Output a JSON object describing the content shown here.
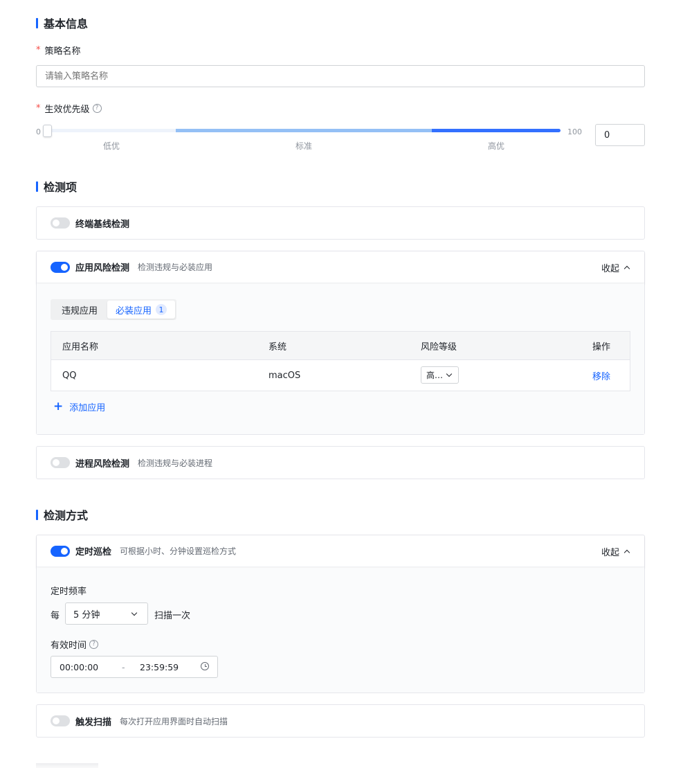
{
  "basic": {
    "title": "基本信息",
    "name_label": "策略名称",
    "name_placeholder": "请输入策略名称",
    "priority_label": "生效优先级",
    "help_glyph": "?",
    "slider": {
      "min": "0",
      "max": "100",
      "value": 0,
      "ticks": [
        "低优",
        "标准",
        "高优"
      ],
      "colors": [
        "#eef3fb",
        "#94c0f5",
        "#3370ff"
      ]
    },
    "priority_value": "0"
  },
  "detect": {
    "title": "检测项",
    "terminal": {
      "title": "终端基线检测",
      "on": false
    },
    "app_risk": {
      "title": "应用风险检测",
      "desc": "检测违规与必装应用",
      "collapse": "收起",
      "on": true,
      "tabs": [
        {
          "label": "违规应用"
        },
        {
          "label": "必装应用",
          "count": "1"
        }
      ],
      "table": {
        "headers": [
          "应用名称",
          "系统",
          "风险等级",
          "操作"
        ],
        "rows": [
          {
            "name": "QQ",
            "system": "macOS",
            "level": "高…",
            "action": "移除"
          }
        ]
      },
      "add": "添加应用"
    },
    "process_risk": {
      "title": "进程风险检测",
      "desc": "检测违规与必装进程",
      "on": false
    }
  },
  "method": {
    "title": "检测方式",
    "scheduled": {
      "title": "定时巡检",
      "desc": "可根据小时、分钟设置巡检方式",
      "collapse": "收起",
      "on": true,
      "freq_label": "定时频率",
      "every": "每",
      "freq_value": "5 分钟",
      "freq_suffix": "扫描一次",
      "valid_label": "有效时间",
      "start": "00:00:00",
      "sep": "-",
      "end": "23:59:59"
    },
    "trigger": {
      "title": "触发扫描",
      "desc": "每次打开应用界面时自动扫描",
      "on": false
    }
  },
  "accent": "#1664ff"
}
